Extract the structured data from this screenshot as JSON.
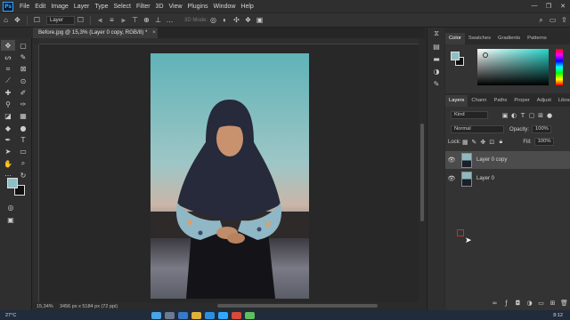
{
  "app": {
    "logo": "Ps"
  },
  "menu": [
    "File",
    "Edit",
    "Image",
    "Layer",
    "Type",
    "Select",
    "Filter",
    "3D",
    "View",
    "Plugins",
    "Window",
    "Help"
  ],
  "window_controls": [
    "—",
    "❐",
    "✕"
  ],
  "options_bar": {
    "auto_select_value": "Layer",
    "mode_3d_label": "3D Mode:"
  },
  "document": {
    "tab_title": "Before.jpg @ 15,3% (Layer 0 copy, RGB/8) *",
    "close_glyph": "×"
  },
  "status": {
    "zoom": "15,34%",
    "size": "3456 px x 5184 px (72 ppi)"
  },
  "color_panel": {
    "tabs": [
      "Color",
      "Swatches",
      "Gradients",
      "Patterns"
    ],
    "active_tab": "Color",
    "foreground": "#8ebfc6",
    "background": "#111111"
  },
  "layers_panel": {
    "tabs": [
      "Layers",
      "Chann",
      "Paths",
      "Proper",
      "Adjust",
      "Librarie"
    ],
    "active_tab": "Layers",
    "filter_label": "Kind",
    "blend_mode": "Normal",
    "opacity_label": "Opacity:",
    "opacity_value": "100%",
    "lock_label": "Lock:",
    "fill_label": "Fill:",
    "fill_value": "100%",
    "layers": [
      {
        "name": "Layer 0 copy",
        "selected": true,
        "visible": true
      },
      {
        "name": "Layer 0",
        "selected": false,
        "visible": true
      }
    ]
  },
  "taskbar": {
    "weather": "27°C",
    "time": "8:12"
  }
}
